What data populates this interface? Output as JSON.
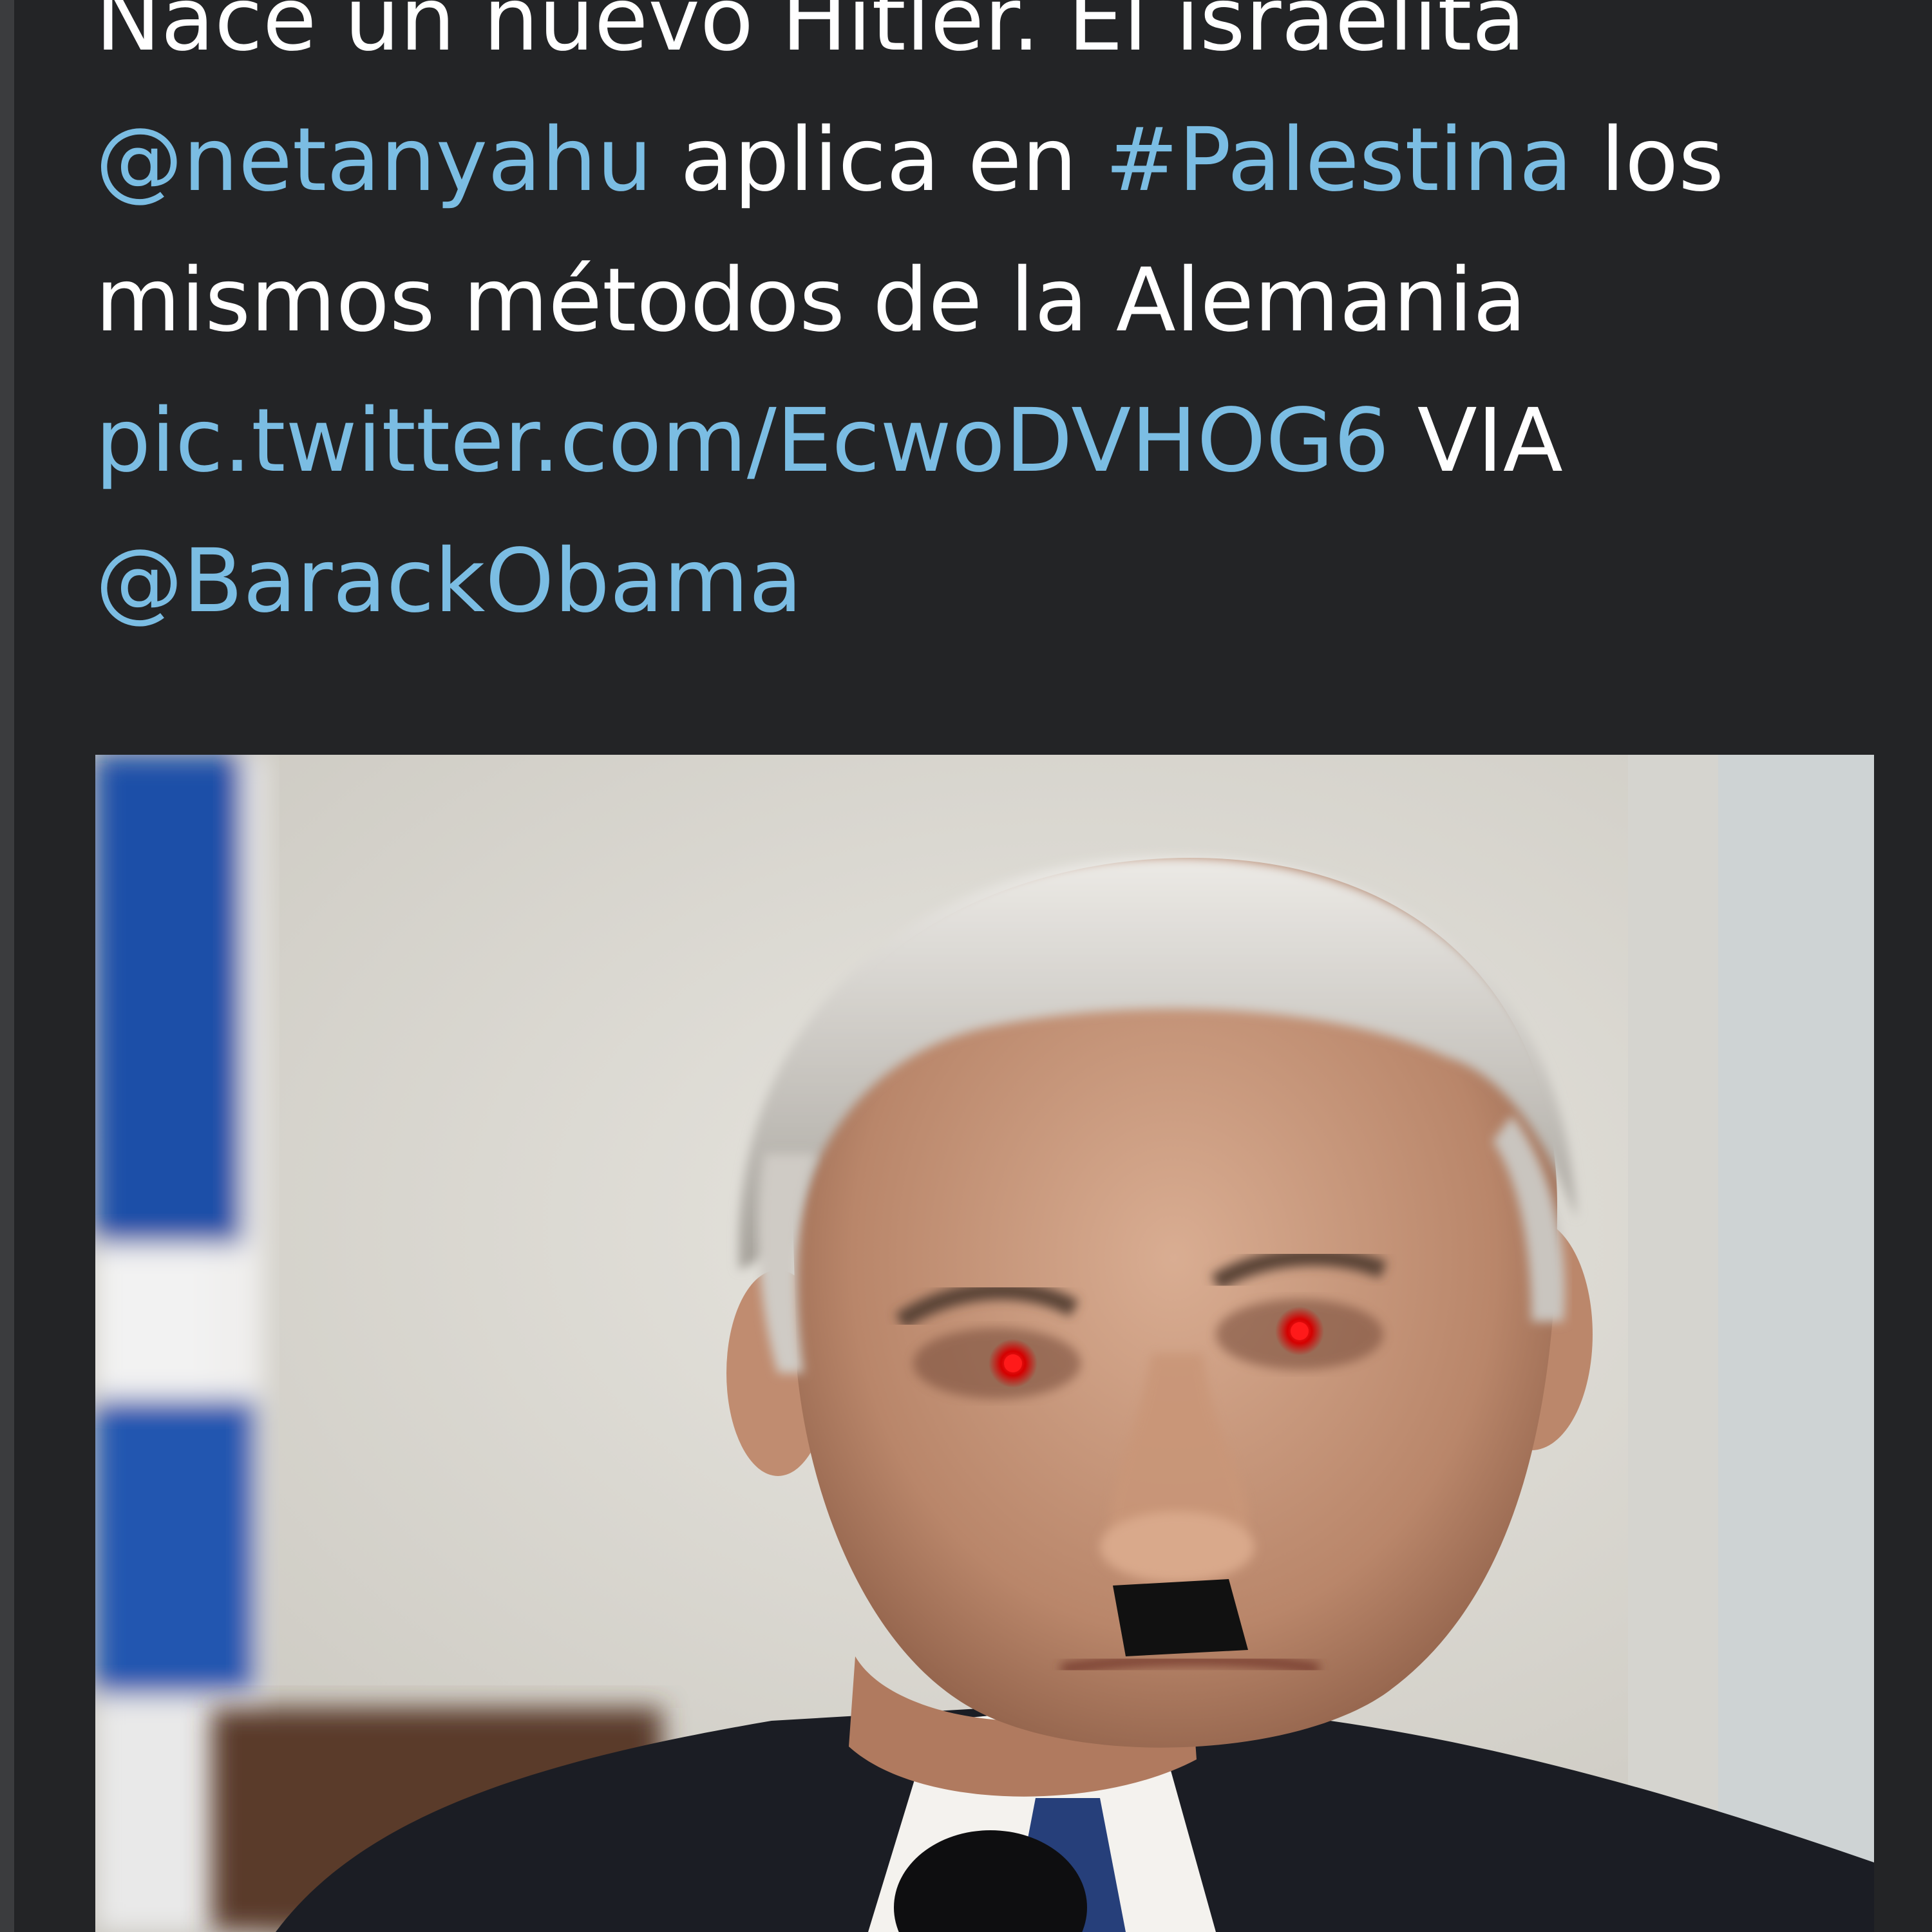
{
  "tweet": {
    "lines": [
      [
        {
          "text": "Nace un nuevo Hitler. El israelita",
          "type": "text"
        }
      ],
      [
        {
          "text": "@netanyahu",
          "type": "mention"
        },
        {
          "text": " aplica en ",
          "type": "text"
        },
        {
          "text": "#Palestina",
          "type": "hashtag"
        },
        {
          "text": " los",
          "type": "text"
        }
      ],
      [
        {
          "text": "mismos métodos de la Alemania",
          "type": "text"
        }
      ],
      [
        {
          "text": "pic.twitter.com/EcwoDVHOG6",
          "type": "link"
        },
        {
          "text": " VIA",
          "type": "text"
        }
      ],
      [
        {
          "text": "@BarackObama",
          "type": "mention"
        }
      ]
    ]
  },
  "media": {
    "kind": "photo",
    "subject": "man-portrait",
    "flag_colors": [
      "#1f4fa8",
      "#f2f2f2"
    ]
  },
  "colors": {
    "background": "#232426",
    "text": "#ffffff",
    "link": "#7bbde3"
  }
}
